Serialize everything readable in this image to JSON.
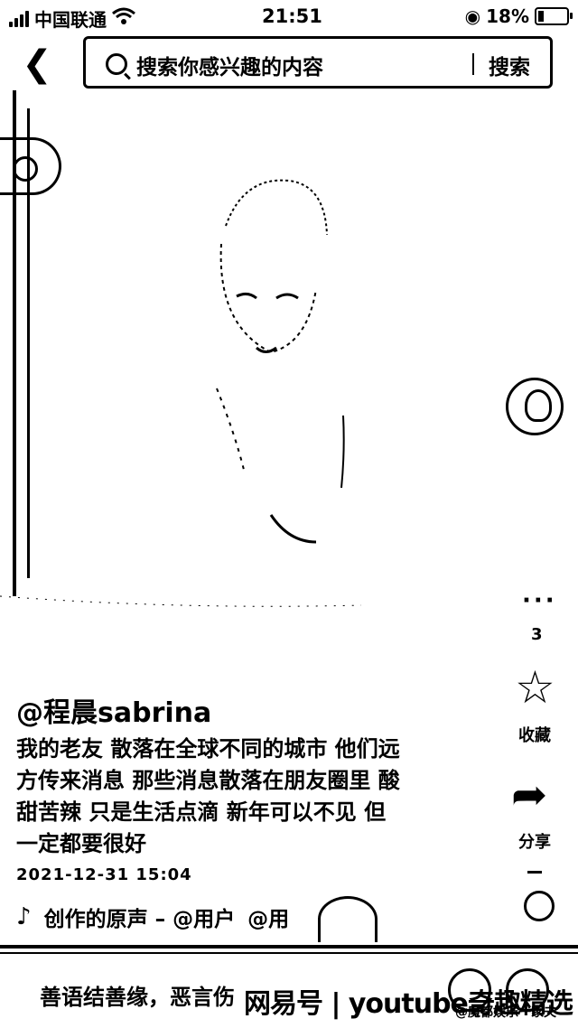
{
  "status_bar": {
    "carrier": "中国联通",
    "time": "21:51",
    "battery": "18%"
  },
  "search": {
    "placeholder": "搜索你感兴趣的内容",
    "button_label": "搜索"
  },
  "post": {
    "username": "@程晨sabrina",
    "caption": "我的老友 散落在全球不同的城市 他们远方传来消息 那些消息散落在朋友圈里 酸甜苦辣 只是生活点滴 新年可以不见 但一定都要很好",
    "datetime": "2021-12-31 15:04",
    "music": "创作的原声 – @用户",
    "music_extra": "@用"
  },
  "rail": {
    "count": "3",
    "favorite_label": "收藏",
    "share_label": "分享"
  },
  "bottom": {
    "text": "善语结善缘，恶言伤",
    "watermark": "网易号 | youtube奇趣精选",
    "watermark_small": "@魔都娱乐一家夫"
  },
  "icons": {
    "back": "chevron-left-icon",
    "search": "search-icon",
    "favorite": "star-icon",
    "share": "share-arrow-icon",
    "comment": "comment-icon",
    "music": "music-note-icon"
  }
}
